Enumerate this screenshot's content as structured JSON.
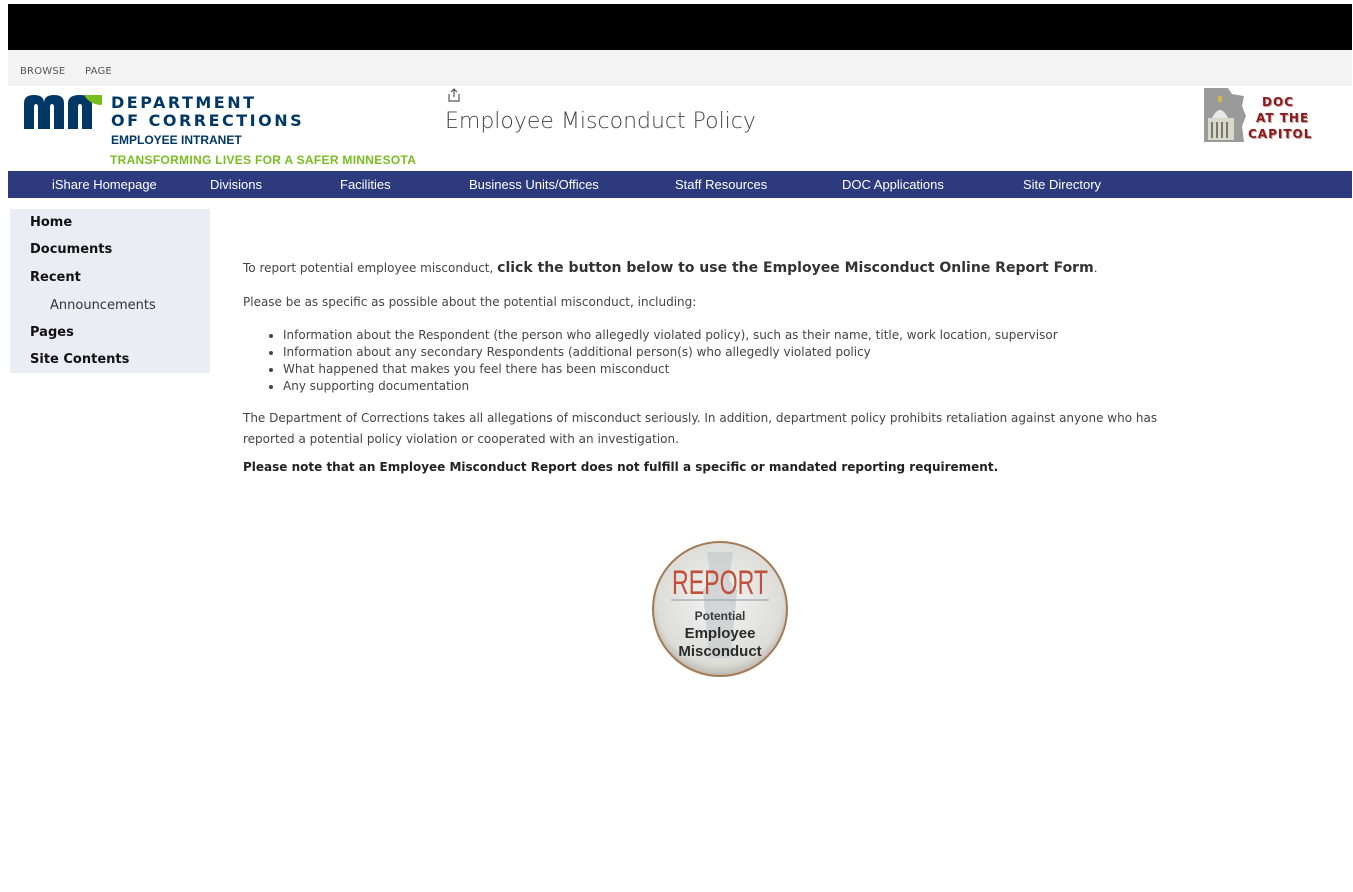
{
  "ribbon": {
    "browse": "BROWSE",
    "page": "PAGE"
  },
  "header": {
    "logo_line1": "DEPARTMENT",
    "logo_line2": "OF CORRECTIONS",
    "logo_line3": "EMPLOYEE INTRANET",
    "tagline": "TRANSFORMING LIVES FOR A SAFER MINNESOTA",
    "page_title": "Employee Misconduct Policy",
    "capitol_line1": "DOC",
    "capitol_line2": "AT THE",
    "capitol_line3": "CAPITOL"
  },
  "topnav": [
    "iShare Homepage",
    "Divisions",
    "Facilities",
    "Business Units/Offices",
    "Staff Resources",
    "DOC Applications",
    "Site Directory"
  ],
  "leftnav": {
    "home": "Home",
    "documents": "Documents",
    "recent": "Recent",
    "announcements": "Announcements",
    "pages": "Pages",
    "site_contents": "Site Contents"
  },
  "content": {
    "intro_prefix": "To report potential employee misconduct, ",
    "intro_bold": "click the button below to use the Employee Misconduct Online Report Form",
    "intro_suffix": ".",
    "specific": "Please be as specific as possible about the potential misconduct, including:",
    "bullets": [
      "Information about the Respondent (the person who allegedly violated policy), such as their name, title, work location, supervisor",
      "Information about any secondary Respondents (additional person(s) who allegedly violated policy",
      "What happened that makes you feel there has been misconduct",
      "Any supporting documentation"
    ],
    "seriously": "The Department of Corrections takes all allegations of misconduct seriously. In addition, department policy prohibits retaliation against anyone who has reported a potential policy violation or cooperated with an investigation.",
    "note": "Please note that an Employee Misconduct Report does not fulfill a specific or mandated reporting requirement."
  },
  "report_button": {
    "line1": "REPORT",
    "line2": "Potential",
    "line3": "Employee",
    "line4": "Misconduct"
  },
  "colors": {
    "nav_bg": "#2d3b7e",
    "brand_blue": "#003865",
    "tagline_green": "#78be20",
    "report_red": "#c0503a"
  }
}
